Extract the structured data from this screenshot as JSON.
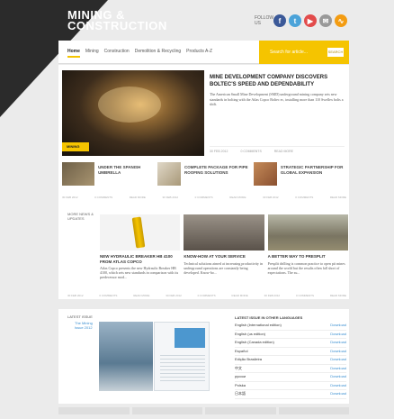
{
  "masthead": {
    "logo_line1": "MINING &",
    "logo_line2": "CONSTRUCTION",
    "follow": "FOLLOW US",
    "social_icons": [
      "facebook-icon",
      "twitter-icon",
      "youtube-icon",
      "email-icon",
      "rss-icon"
    ],
    "social_colors": [
      "#3b5998",
      "#4ba3d9",
      "#e24b4b",
      "#999999",
      "#f39c12"
    ]
  },
  "nav": {
    "items": [
      "Home",
      "Mining",
      "Construction",
      "Demolition & Recycling",
      "Products A-Z"
    ]
  },
  "search": {
    "placeholder": "Search for article...",
    "button": "SEARCH"
  },
  "hero": {
    "tag": "MINING",
    "title": "MINE DEVELOPMENT COMPANY DISCOVERS BOLTEC'S SPEED AND DEPENDABILITY",
    "body": "The American Small Mine Development (SMD) underground mining company sets new standards in bolting with the Atlas Copco Boltec ec, installing more than 110 Swellex bolts a shift.",
    "meta": [
      "30 FEB 2012",
      "0 COMMENTS",
      "READ MORE"
    ]
  },
  "minis": [
    {
      "title": "UNDER THE SPANISH UMBRELLA",
      "color": "#8a7a5a"
    },
    {
      "title": "COMPLETE PACKAGE FOR PIPE ROOFING SOLUTIONS",
      "color": "#b8a890"
    },
    {
      "title": "STRATEGIC PARTNERSHIP FOR GLOBAL EXPANSION",
      "color": "#b06a3a"
    }
  ],
  "row_meta": [
    "30 FEB 2012",
    "0 COMMENTS",
    "READ MORE",
    "30 FEB 2012",
    "0 COMMENTS",
    "READ MORE",
    "30 FEB 2012",
    "0 COMMENTS",
    "READ MORE"
  ],
  "news": {
    "side": "MORE NEWS & UPDATES",
    "items": [
      {
        "title": "NEW HYDRAULIC BREAKER HB 4100 FROM ATLAS COPCO",
        "desc": "Atlas Copco presents the new Hydraulic Breaker HB 4100, which sets new standards in comparison with its predecessor mod...",
        "color": "#f0f0f0"
      },
      {
        "title": "KNOW-HOW AT YOUR SERVICE",
        "desc": "Technical solutions aimed at increasing productivity in underground operations are constantly being developed. Know-ho...",
        "color": "#7c7468"
      },
      {
        "title": "A BETTER WAY TO PRESPLIT",
        "desc": "Presplit drilling is common practice to open pit mines around the world but the results often fall short of expectations. The su...",
        "color": "#8f8a74"
      }
    ],
    "meta": [
      "30 FEB 2012",
      "0 COMMENTS",
      "READ MORE",
      "30 FEB 2012",
      "0 COMMENTS",
      "READ MORE",
      "30 FEB 2012",
      "0 COMMENTS",
      "READ MORE"
    ]
  },
  "issue": {
    "side": "LATEST ISSUE",
    "side_sub": "The Mining Issue 2012",
    "download_title": "LATEST ISSUE IN OTHER LANGUAGES",
    "languages": [
      {
        "lang": "English (International edition)",
        "link": "Download"
      },
      {
        "lang": "English (us edition)",
        "link": "Download"
      },
      {
        "lang": "English (Canada edition)",
        "link": "Download"
      },
      {
        "lang": "Español",
        "link": "Download"
      },
      {
        "lang": "Edição Brasileira",
        "link": "Download"
      },
      {
        "lang": "中文",
        "link": "Download"
      },
      {
        "lang": "русски",
        "link": "Download"
      },
      {
        "lang": "Polska",
        "link": "Download"
      },
      {
        "lang": "日本語",
        "link": "Download"
      }
    ]
  }
}
